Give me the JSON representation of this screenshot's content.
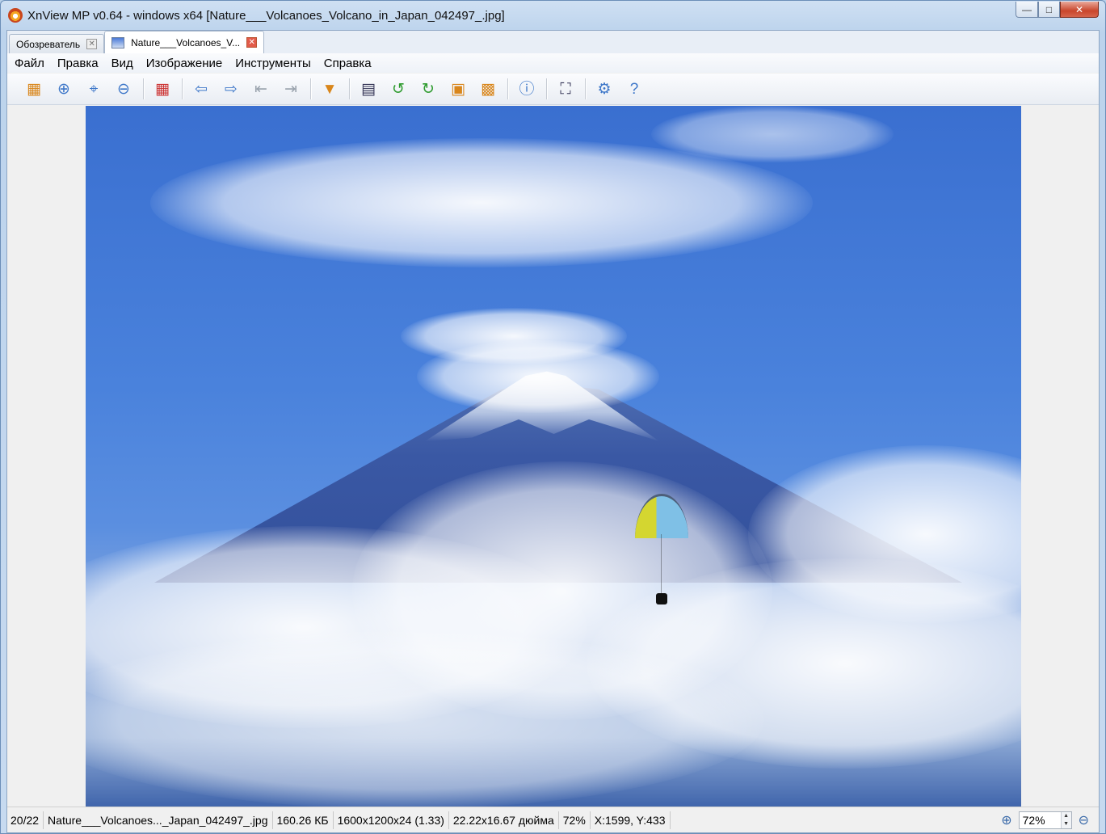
{
  "window": {
    "title": "XnView MP v0.64 - windows x64 [Nature___Volcanoes_Volcano_in_Japan_042497_.jpg]",
    "minimize_glyph": "—",
    "maximize_glyph": "□",
    "close_glyph": "✕"
  },
  "tabs": [
    {
      "label": "Обозреватель",
      "close": "✕"
    },
    {
      "label": "Nature___Volcanoes_V...",
      "close": "✕"
    }
  ],
  "menu": [
    "Файл",
    "Правка",
    "Вид",
    "Изображение",
    "Инструменты",
    "Справка"
  ],
  "toolbar": {
    "icons": [
      {
        "name": "browser-icon",
        "glyph": "▦"
      },
      {
        "name": "zoom-in-icon",
        "glyph": "⊕"
      },
      {
        "name": "zoom-fit-icon",
        "glyph": "⌖"
      },
      {
        "name": "zoom-out-icon",
        "glyph": "⊖"
      },
      {
        "name": "grid-icon",
        "glyph": "▦"
      },
      {
        "name": "previous-icon",
        "glyph": "⇦"
      },
      {
        "name": "next-icon",
        "glyph": "⇨"
      },
      {
        "name": "first-icon",
        "glyph": "⇤"
      },
      {
        "name": "last-icon",
        "glyph": "⇥"
      },
      {
        "name": "slideshow-icon",
        "glyph": "▼"
      },
      {
        "name": "adjust-colors-icon",
        "glyph": "▤"
      },
      {
        "name": "rotate-left-icon",
        "glyph": "↺"
      },
      {
        "name": "rotate-right-icon",
        "glyph": "↻"
      },
      {
        "name": "crop-icon",
        "glyph": "▣"
      },
      {
        "name": "resize-icon",
        "glyph": "▩"
      },
      {
        "name": "info-icon",
        "glyph": "ⓘ"
      },
      {
        "name": "fullscreen-icon",
        "glyph": "⛶"
      },
      {
        "name": "settings-icon",
        "glyph": "⚙"
      },
      {
        "name": "help-icon",
        "glyph": "?"
      }
    ]
  },
  "status": {
    "index": "20/22",
    "filename": "Nature___Volcanoes..._Japan_042497_.jpg",
    "filesize": "160.26 КБ",
    "dimensions": "1600x1200x24 (1.33)",
    "print_size": "22.22x16.67 дюйма",
    "zoom": "72%",
    "cursor": "X:1599, Y:433",
    "zoom_field": "72%",
    "zoom_in_glyph": "⊕",
    "zoom_out_glyph": "⊖"
  }
}
